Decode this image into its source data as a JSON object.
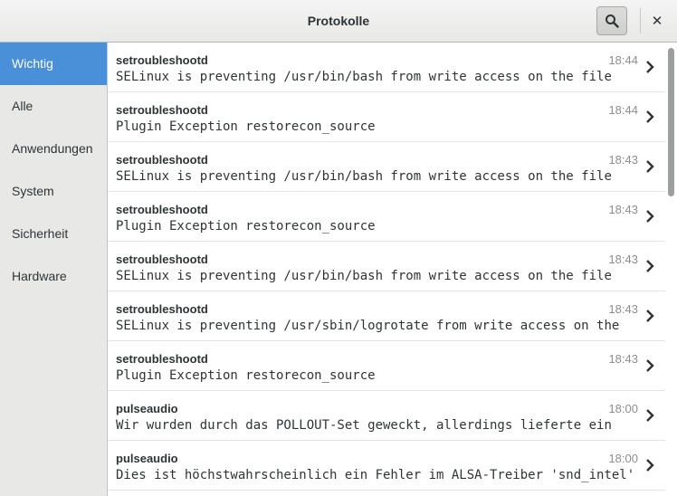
{
  "window": {
    "title": "Protokolle",
    "close_glyph": "✕"
  },
  "sidebar": {
    "items": [
      {
        "label": "Wichtig",
        "active": true
      },
      {
        "label": "Alle"
      },
      {
        "label": "Anwendungen"
      },
      {
        "label": "System"
      },
      {
        "label": "Sicherheit"
      },
      {
        "label": "Hardware"
      }
    ]
  },
  "events": [
    {
      "source": "setroubleshootd",
      "time": "18:44",
      "message": "SELinux is preventing /usr/bin/bash from write access on the file"
    },
    {
      "source": "setroubleshootd",
      "time": "18:44",
      "message": "Plugin Exception restorecon_source"
    },
    {
      "source": "setroubleshootd",
      "time": "18:43",
      "message": "SELinux is preventing /usr/bin/bash from write access on the file"
    },
    {
      "source": "setroubleshootd",
      "time": "18:43",
      "message": "Plugin Exception restorecon_source"
    },
    {
      "source": "setroubleshootd",
      "time": "18:43",
      "message": "SELinux is preventing /usr/bin/bash from write access on the file"
    },
    {
      "source": "setroubleshootd",
      "time": "18:43",
      "message": "SELinux is preventing /usr/sbin/logrotate from write access on the"
    },
    {
      "source": "setroubleshootd",
      "time": "18:43",
      "message": "Plugin Exception restorecon_source"
    },
    {
      "source": "pulseaudio",
      "time": "18:00",
      "message": "Wir wurden durch das POLLOUT-Set geweckt, allerdings lieferte ein"
    },
    {
      "source": "pulseaudio",
      "time": "18:00",
      "message": "Dies ist höchstwahrscheinlich ein Fehler im ALSA-Treiber 'snd_intel'"
    }
  ],
  "icons": {
    "search": "search-icon",
    "close": "close-icon",
    "row_arrow": "chevron-right-icon"
  },
  "colors": {
    "accent": "#4a90d9",
    "time_text": "#8b8e8f",
    "text": "#2e3436"
  }
}
